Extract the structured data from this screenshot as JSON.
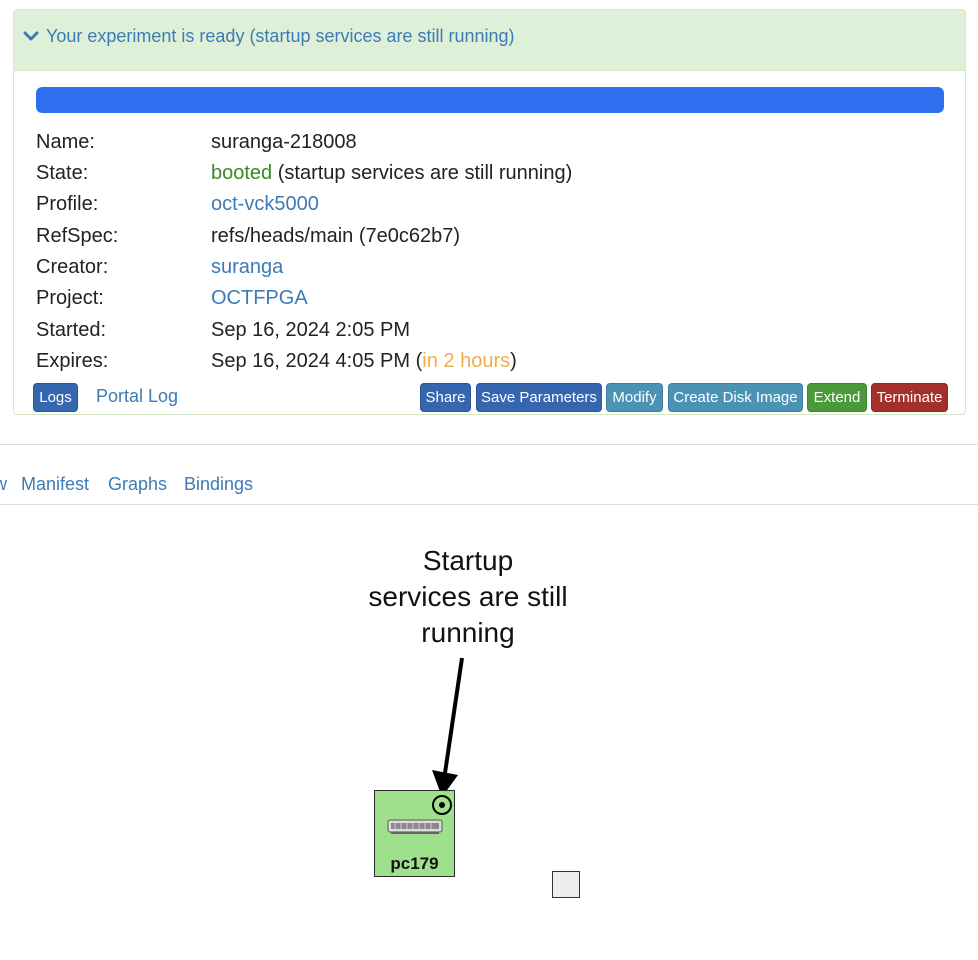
{
  "panel": {
    "title": "Your experiment is ready (startup services are still running)",
    "progress_fraction": 1.0,
    "progress_color": "#2e6ff0"
  },
  "info": {
    "name": {
      "label": "Name:",
      "value": "suranga-218008"
    },
    "state": {
      "label": "State:",
      "value": "booted",
      "suffix": " (startup services are still running)"
    },
    "profile": {
      "label": "Profile:",
      "value": "oct-vck5000"
    },
    "refspec": {
      "label": "RefSpec:",
      "value": "refs/heads/main (7e0c62b7)"
    },
    "creator": {
      "label": "Creator:",
      "value": "suranga"
    },
    "project": {
      "label": "Project:",
      "value": "OCTFPGA"
    },
    "started": {
      "label": "Started:",
      "value": "Sep 16, 2024 2:05 PM"
    },
    "expires": {
      "label": "Expires:",
      "value": "Sep 16, 2024 4:05 PM",
      "paren_open": " (",
      "relative": "in 2 hours",
      "paren_close": ")"
    }
  },
  "buttons": {
    "logs": "Logs",
    "portal_log": "Portal Log",
    "share": "Share",
    "save_parameters": "Save Parameters",
    "modify": "Modify",
    "create_disk_image": "Create Disk Image",
    "extend": "Extend",
    "terminate": "Terminate"
  },
  "tabs": [
    "w",
    "Manifest",
    "Graphs",
    "Bindings"
  ],
  "topology": {
    "annotation": "Startup services are still running",
    "node_label": "pc179",
    "node_color": "#9ee08c"
  },
  "colors": {
    "link": "#3c7bb5",
    "booted": "#3a8a1f",
    "expires_relative": "#f0ad4e",
    "panel_heading_bg": "#dff0d8"
  }
}
